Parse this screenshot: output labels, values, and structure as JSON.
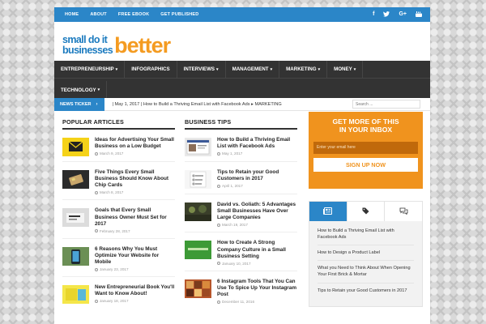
{
  "topbar": {
    "nav": [
      "Home",
      "About",
      "Free Ebook",
      "Get Published"
    ],
    "social": [
      "facebook-icon",
      "twitter-icon",
      "google-plus-icon",
      "youtube-icon"
    ]
  },
  "logo": {
    "line1": "small  do it",
    "line2": "businesses",
    "big": "better"
  },
  "mainnav": {
    "row1": [
      {
        "label": "Entrepreneurship",
        "dropdown": true
      },
      {
        "label": "Infographics",
        "dropdown": false
      },
      {
        "label": "Interviews",
        "dropdown": true
      },
      {
        "label": "Management",
        "dropdown": true
      },
      {
        "label": "Marketing",
        "dropdown": true
      },
      {
        "label": "Money",
        "dropdown": true
      }
    ],
    "row2": [
      {
        "label": "Technology",
        "dropdown": true
      }
    ]
  },
  "ticker": {
    "label": "News Ticker",
    "text": "| May 1, 2017 | How to Build a Thriving Email List with Facebook Ads  ▸ MARKETING",
    "search_placeholder": "Search ..."
  },
  "popular": {
    "title": "Popular Articles",
    "items": [
      {
        "title": "Ideas for Advertising Your Small Business on a Low Budget",
        "date": "March 9, 2017"
      },
      {
        "title": "Five Things Every Small Business Should Know About Chip Cards",
        "date": "March 8, 2017"
      },
      {
        "title": "Goals that Every Small Business Owner Must Set for 2017",
        "date": "February 28, 2017"
      },
      {
        "title": "6 Reasons Why You Must Optimize Your Website for Mobile",
        "date": "January 23, 2017"
      },
      {
        "title": "New Entrepreneurial Book You'll Want to Know About!",
        "date": "January 18, 2017"
      }
    ]
  },
  "business": {
    "title": "Business Tips",
    "items": [
      {
        "title": "How to Build a Thriving Email List with Facebook Ads",
        "date": "May 1, 2017"
      },
      {
        "title": "Tips to Retain your Good Customers in 2017",
        "date": "April 1, 2017"
      },
      {
        "title": "David vs. Goliath: 5 Advantages Small Businesses Have Over Large Companies",
        "date": "March 19, 2017"
      },
      {
        "title": "How to Create A Strong Company Culture in a Small Business Setting",
        "date": "January 10, 2017"
      },
      {
        "title": "6 Instagram Tools That You Can Use To Spice Up Your Instagram Post",
        "date": "December 11, 2016"
      }
    ]
  },
  "promo": {
    "title_line1": "Get more of this",
    "title_line2": "in your inbox",
    "email_placeholder": "Enter your email here",
    "button": "Sign Up Now"
  },
  "tabbox": {
    "tabs": [
      "newspaper-icon",
      "tags-icon",
      "comments-icon"
    ],
    "items": [
      "How to Build a Thriving Email List with Facebook Ads",
      "How to Design a Product Label",
      "What you Need to Think About When Opening Your First Brick & Mortar",
      "Tips to Retain your Good Customers in 2017"
    ]
  },
  "colors": {
    "blue": "#2b86c8",
    "orange": "#f0931e",
    "dark": "#333333"
  }
}
